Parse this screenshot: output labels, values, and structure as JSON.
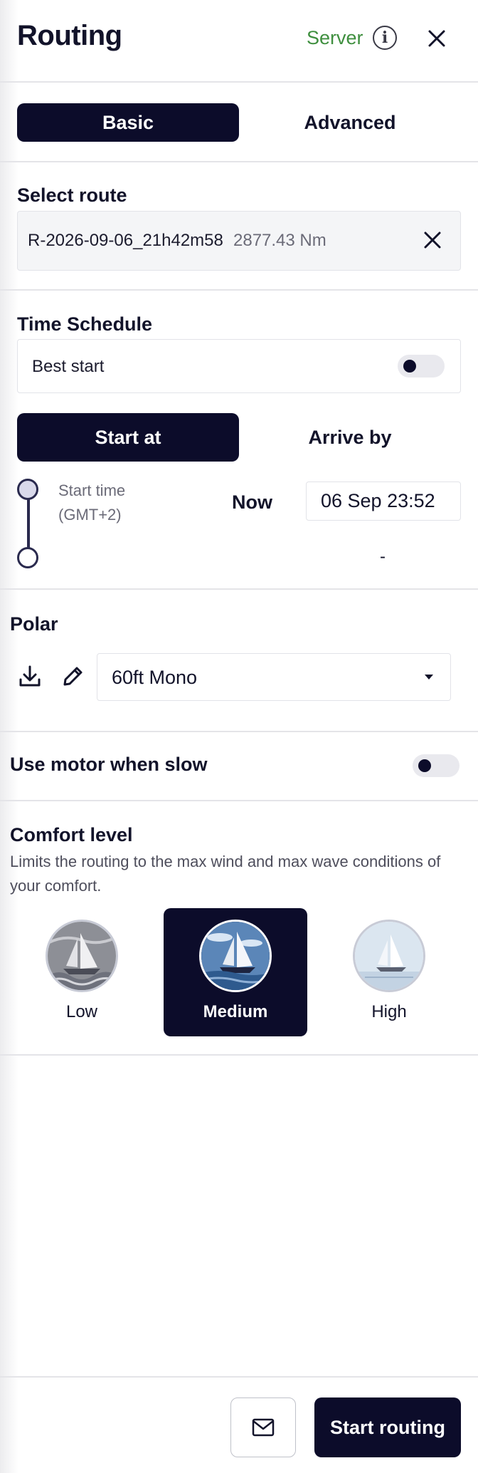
{
  "header": {
    "title": "Routing",
    "server_label": "Server",
    "info_icon_glyph": "i",
    "server_color": "#3f8f3f"
  },
  "tabs": [
    {
      "label": "Basic",
      "active": true
    },
    {
      "label": "Advanced",
      "active": false
    }
  ],
  "route": {
    "section_label": "Select route",
    "name": "R-2026-09-06_21h42m58",
    "distance": "2877.43 Nm"
  },
  "schedule": {
    "section_label": "Time Schedule",
    "best_start_label": "Best start",
    "best_start_on": false,
    "modes": [
      {
        "label": "Start at",
        "active": true
      },
      {
        "label": "Arrive by",
        "active": false
      }
    ],
    "start_time_label": "Start time\n(GMT+2)",
    "now_label": "Now",
    "start_time_value": "06 Sep 23:52",
    "arrival_value": "-"
  },
  "polar": {
    "section_label": "Polar",
    "selected": "60ft Mono"
  },
  "motor": {
    "label": "Use motor when slow",
    "on": false
  },
  "comfort": {
    "section_label": "Comfort level",
    "description": "Limits the routing to the max wind and max wave conditions of your comfort.",
    "options": [
      {
        "label": "Low",
        "active": false
      },
      {
        "label": "Medium",
        "active": true
      },
      {
        "label": "High",
        "active": false
      }
    ]
  },
  "footer": {
    "start_label": "Start routing"
  },
  "colors": {
    "primary": "#0c0c2a",
    "divider": "#e4e4e8"
  }
}
